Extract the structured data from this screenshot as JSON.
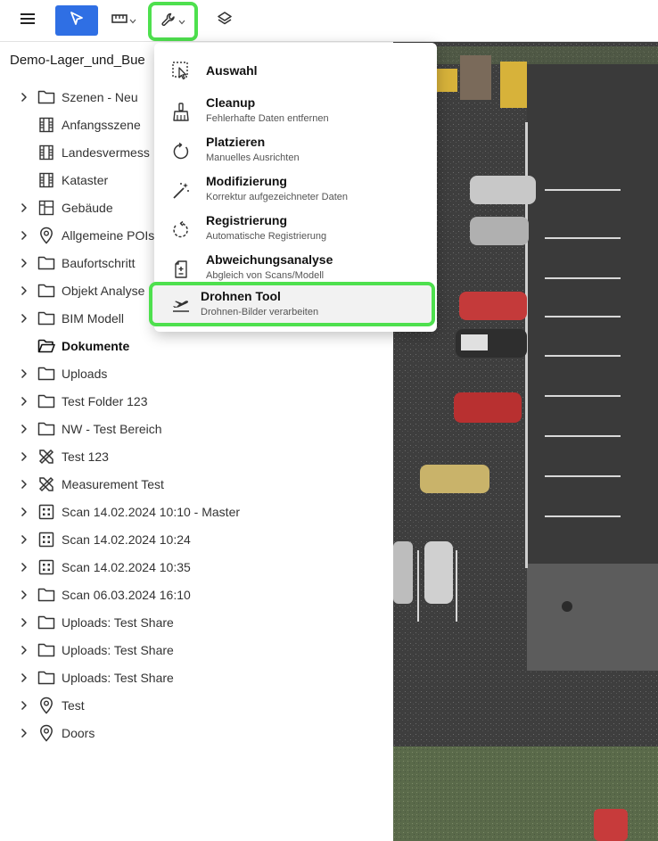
{
  "sidebar": {
    "title": "Demo-Lager_und_Bue",
    "items": [
      {
        "label": "Szenen - Neu",
        "icon": "folder-icon",
        "expandable": true,
        "bold": false
      },
      {
        "label": "Anfangsszene",
        "icon": "film-icon",
        "expandable": false,
        "bold": false
      },
      {
        "label": "Landesvermess",
        "icon": "film-icon",
        "expandable": false,
        "bold": false
      },
      {
        "label": "Kataster",
        "icon": "film-icon",
        "expandable": false,
        "bold": false
      },
      {
        "label": "Gebäude",
        "icon": "floorplan-icon",
        "expandable": true,
        "bold": false
      },
      {
        "label": "Allgemeine POIs",
        "icon": "pin-icon",
        "expandable": true,
        "bold": false
      },
      {
        "label": "Baufortschritt",
        "icon": "folder-icon",
        "expandable": true,
        "bold": false
      },
      {
        "label": "Objekt Analyse",
        "icon": "folder-icon",
        "expandable": true,
        "bold": false
      },
      {
        "label": "BIM Modell",
        "icon": "folder-icon",
        "expandable": true,
        "bold": false
      },
      {
        "label": "Dokumente",
        "icon": "folder-open-icon",
        "expandable": false,
        "bold": true
      },
      {
        "label": "Uploads",
        "icon": "folder-icon",
        "expandable": true,
        "bold": false
      },
      {
        "label": "Test Folder 123",
        "icon": "folder-icon",
        "expandable": true,
        "bold": false
      },
      {
        "label": "NW - Test Bereich",
        "icon": "folder-icon",
        "expandable": true,
        "bold": false
      },
      {
        "label": "Test 123",
        "icon": "measure-tools-icon",
        "expandable": true,
        "bold": false
      },
      {
        "label": "Measurement Test",
        "icon": "measure-tools-icon",
        "expandable": true,
        "bold": false
      },
      {
        "label": "Scan 14.02.2024 10:10 - Master",
        "icon": "scan-grid-icon",
        "expandable": true,
        "bold": false
      },
      {
        "label": "Scan 14.02.2024 10:24",
        "icon": "scan-grid-icon",
        "expandable": true,
        "bold": false
      },
      {
        "label": "Scan 14.02.2024 10:35",
        "icon": "scan-grid-icon",
        "expandable": true,
        "bold": false
      },
      {
        "label": "Scan 06.03.2024 16:10",
        "icon": "folder-icon",
        "expandable": true,
        "bold": false
      },
      {
        "label": "Uploads: Test Share",
        "icon": "folder-icon",
        "expandable": true,
        "bold": false
      },
      {
        "label": "Uploads: Test Share",
        "icon": "folder-icon",
        "expandable": true,
        "bold": false
      },
      {
        "label": "Uploads: Test Share",
        "icon": "folder-icon",
        "expandable": true,
        "bold": false
      },
      {
        "label": "Test",
        "icon": "pin-icon",
        "expandable": true,
        "bold": false
      },
      {
        "label": "Doors",
        "icon": "pin-icon",
        "expandable": true,
        "bold": false
      }
    ]
  },
  "toolbar": {
    "icons": [
      "menu-icon",
      "select-cursor-icon",
      "measure-ruler-icon",
      "wrench-icon",
      "layers-icon"
    ],
    "accent": "#2f6fe4",
    "highlight": "#4ee04e"
  },
  "tools_menu": {
    "items": [
      {
        "label": "Auswahl",
        "sub": "",
        "icon": "selection-icon"
      },
      {
        "label": "Cleanup",
        "sub": "Fehlerhafte Daten entfernen",
        "icon": "broom-icon"
      },
      {
        "label": "Platzieren",
        "sub": "Manuelles Ausrichten",
        "icon": "rotate-icon"
      },
      {
        "label": "Modifizierung",
        "sub": "Korrektur aufgezeichneter Daten",
        "icon": "magic-wand-icon"
      },
      {
        "label": "Registrierung",
        "sub": "Automatische Registrierung",
        "icon": "auto-rotate-icon"
      },
      {
        "label": "Abweichungsanalyse",
        "sub": "Abgleich von Scans/Modell",
        "icon": "deviation-doc-icon"
      },
      {
        "label": "Drohnen Tool",
        "sub": "Drohnen-Bilder verarbeiten",
        "icon": "drone-takeoff-icon"
      }
    ],
    "active_index": 6
  }
}
